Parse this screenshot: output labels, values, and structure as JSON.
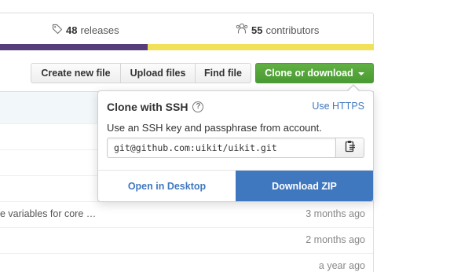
{
  "summary": {
    "releases": {
      "count": "48",
      "label": "releases",
      "icon": "tag-icon"
    },
    "contributors": {
      "count": "55",
      "label": "contributors",
      "icon": "people-icon"
    },
    "languages": [
      {
        "name": "",
        "color": "#563d7c"
      },
      {
        "name": "",
        "color": "#f1e05a"
      }
    ]
  },
  "file_nav": {
    "create_new_file": "Create new file",
    "upload_files": "Upload files",
    "find_file": "Find file",
    "clone_or_download": "Clone or download",
    "clone_color": "#60b044"
  },
  "clone_popover": {
    "title": "Clone with SSH",
    "help_glyph": "?",
    "use_https": "Use HTTPS",
    "description": "Use an SSH key and passphrase from account.",
    "clone_url": "git@github.com:uikit/uikit.git",
    "open_in_desktop": "Open in Desktop",
    "download_zip": "Download ZIP",
    "accent_color": "#4078c0"
  },
  "files": [
    {
      "message": "e variables for core …",
      "age": "3 months ago"
    },
    {
      "message": "",
      "age": "2 months ago"
    },
    {
      "message": "",
      "age": "a year ago"
    }
  ]
}
